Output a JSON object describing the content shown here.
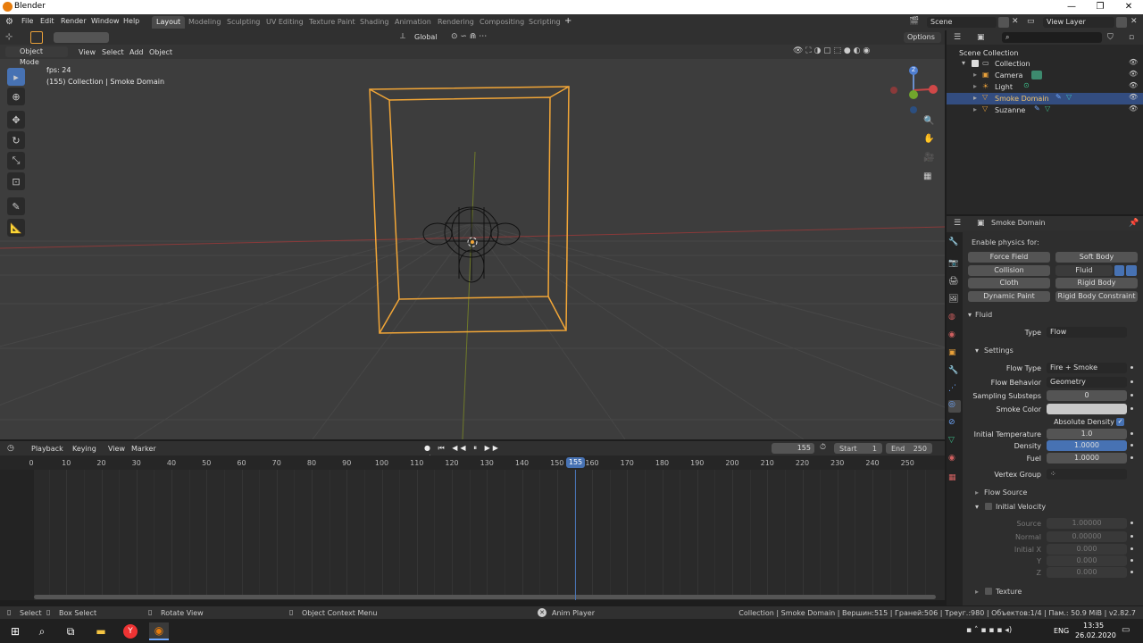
{
  "app": {
    "title": "Blender"
  },
  "window_controls": {
    "minimize": "—",
    "maximize": "❐",
    "close": "✕"
  },
  "menu": [
    "File",
    "Edit",
    "Render",
    "Window",
    "Help"
  ],
  "workspaces": [
    "Layout",
    "Modeling",
    "Sculpting",
    "UV Editing",
    "Texture Paint",
    "Shading",
    "Animation",
    "Rendering",
    "Compositing",
    "Scripting"
  ],
  "workspace_add": "+",
  "scene": {
    "name": "Scene",
    "view_layer": "View Layer"
  },
  "viewport_header": {
    "orientation": "Global",
    "options": "Options",
    "mode": "Object Mode",
    "menus": [
      "View",
      "Select",
      "Add",
      "Object"
    ]
  },
  "viewport_overlay": {
    "fps": "fps: 24",
    "info": "(155) Collection | Smoke Domain"
  },
  "gizmo": {
    "z": "Z"
  },
  "outliner": {
    "root": "Scene Collection",
    "collection": "Collection",
    "items": [
      "Camera",
      "Light",
      "Smoke Domain",
      "Suzanne"
    ]
  },
  "properties": {
    "object_name": "Smoke Domain",
    "enable_physics_label": "Enable physics for:",
    "physics_buttons": [
      "Force Field",
      "Soft Body",
      "Collision",
      "Fluid",
      "Cloth",
      "Rigid Body",
      "Dynamic Paint",
      "Rigid Body Constraint"
    ],
    "fluid_panel": "Fluid",
    "type_label": "Type",
    "type_value": "Flow",
    "settings_panel": "Settings",
    "flow_type_label": "Flow Type",
    "flow_type_value": "Fire + Smoke",
    "flow_behavior_label": "Flow Behavior",
    "flow_behavior_value": "Geometry",
    "sampling_label": "Sampling Substeps",
    "sampling_value": "0",
    "smoke_color_label": "Smoke Color",
    "smoke_color": "#c9c9c9",
    "absolute_density_label": "Absolute Density",
    "initial_temp_label": "Initial Temperature",
    "initial_temp_value": "1.0",
    "density_label": "Density",
    "density_value": "1.0000",
    "fuel_label": "Fuel",
    "fuel_value": "1.0000",
    "vertex_group_label": "Vertex Group",
    "flow_source_panel": "Flow Source",
    "initial_velocity_panel": "Initial Velocity",
    "source_label": "Source",
    "source_value": "1.00000",
    "normal_label": "Normal",
    "normal_value": "0.00000",
    "initial_x_label": "Initial X",
    "initial_x_value": "0.000",
    "y_label": "Y",
    "y_value": "0.000",
    "z_label": "Z",
    "z_value": "0.000",
    "texture_panel": "Texture"
  },
  "timeline": {
    "menus": [
      "Playback",
      "Keying",
      "View",
      "Marker"
    ],
    "current_frame": "155",
    "start_label": "Start",
    "start_value": "1",
    "end_label": "End",
    "end_value": "250",
    "ticks": [
      "0",
      "10",
      "20",
      "30",
      "40",
      "50",
      "60",
      "70",
      "80",
      "90",
      "100",
      "110",
      "120",
      "130",
      "140",
      "150",
      "160",
      "170",
      "180",
      "190",
      "200",
      "210",
      "220",
      "230",
      "240",
      "250"
    ]
  },
  "statusbar": {
    "select": "Select",
    "box_select": "Box Select",
    "rotate_view": "Rotate View",
    "context_menu": "Object Context Menu",
    "anim_player": "Anim Player",
    "stats": "Collection | Smoke Domain | Вершин:515 | Граней:506 | Треуг.:980 | Объектов:1/4 | Пам.: 50.9 MiB | v2.82.7"
  },
  "taskbar": {
    "lang": "ENG",
    "time": "13:35",
    "date": "26.02.2020"
  },
  "colors": {
    "accent": "#4772b3",
    "selection": "#f2a637",
    "active_workspace": "#4a4a4a",
    "orange_icon": "#e87d0d"
  }
}
